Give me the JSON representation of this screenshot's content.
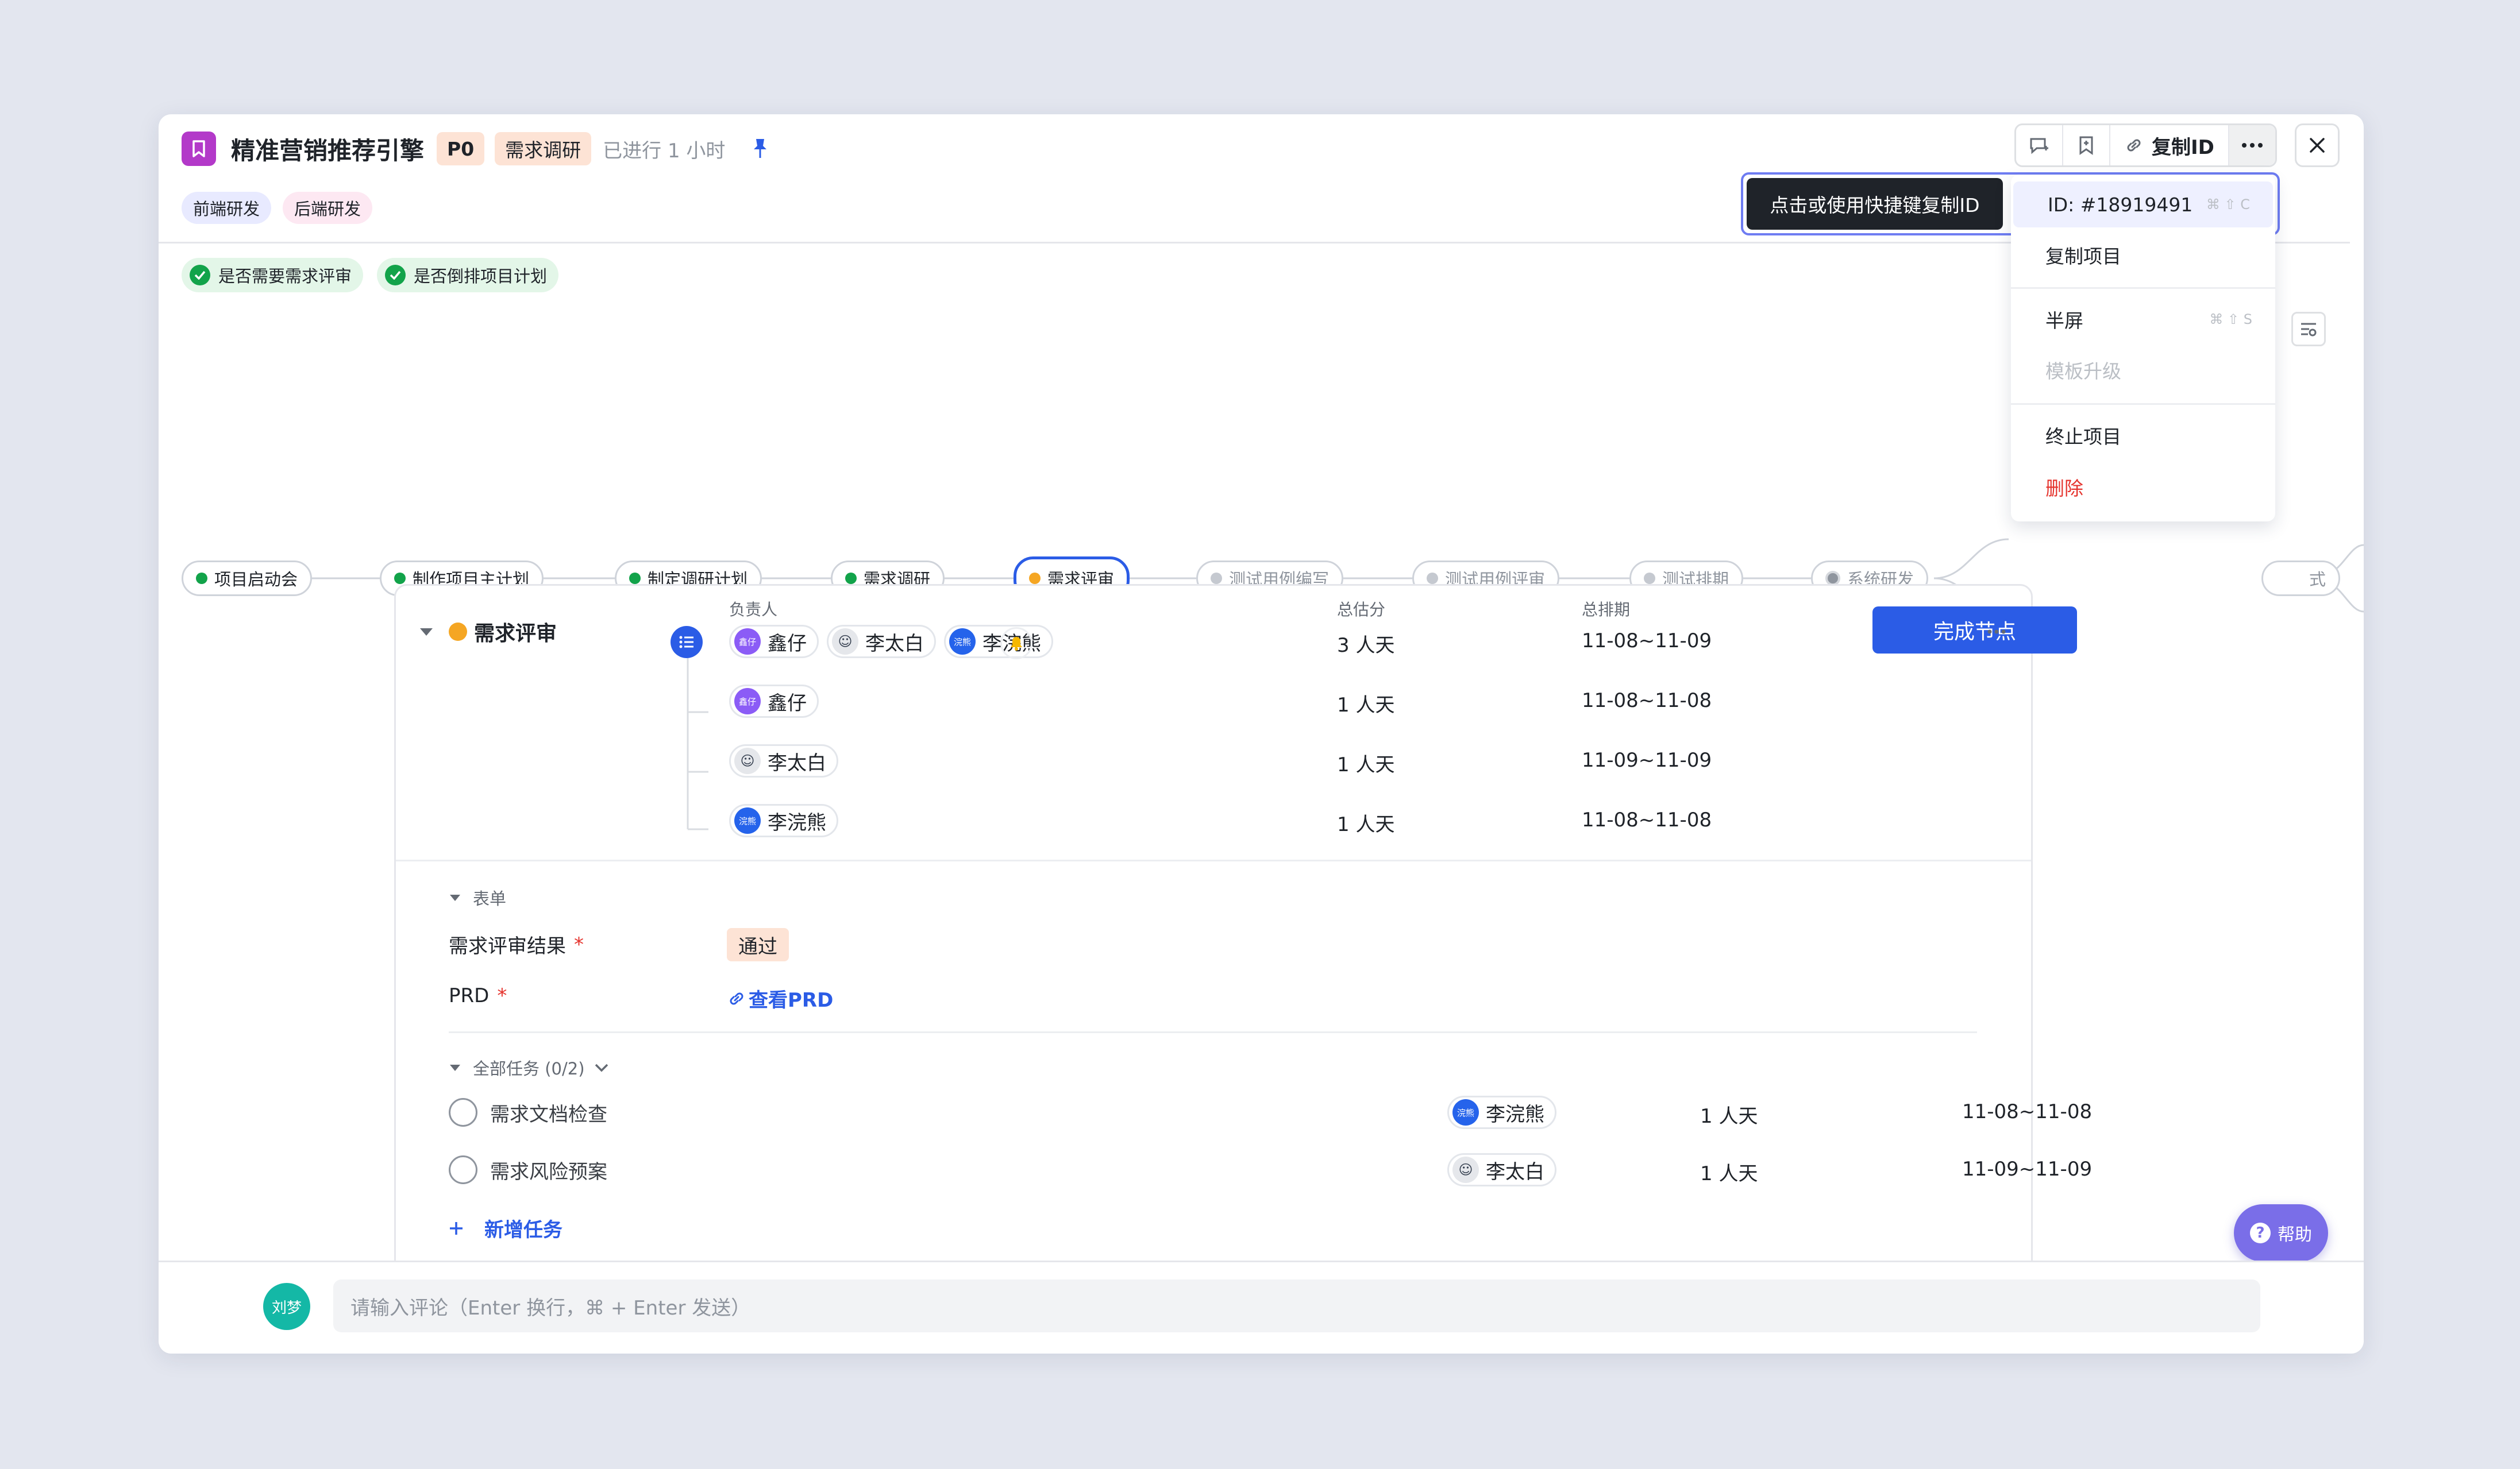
{
  "header": {
    "title": "精准营销推荐引擎",
    "priority": "P0",
    "stage": "需求调研",
    "elapsed": "已进行 1 小时",
    "copy_id_label": "复制ID"
  },
  "tags": [
    "前端研发",
    "后端研发"
  ],
  "checks": [
    "是否需要需求评审",
    "是否倒排项目计划"
  ],
  "tooltip": "点击或使用快捷键复制ID",
  "menu": {
    "id_label": "ID: #18919491",
    "id_shortcut": "⌘ ⇧ C",
    "copy_project": "复制项目",
    "half_screen": "半屏",
    "half_shortcut": "⌘ ⇧ S",
    "template_upgrade": "模板升级",
    "terminate": "终止项目",
    "delete": "删除"
  },
  "flow": {
    "nodes": [
      {
        "label": "项目启动会",
        "status": "done"
      },
      {
        "label": "制作项目主计划",
        "status": "done"
      },
      {
        "label": "制定调研计划",
        "status": "done"
      },
      {
        "label": "需求调研",
        "status": "done"
      },
      {
        "label": "需求评审",
        "status": "current"
      },
      {
        "label": "测试用例编写",
        "status": "todo"
      },
      {
        "label": "测试用例评审",
        "status": "todo"
      },
      {
        "label": "测试排期",
        "status": "todo"
      },
      {
        "label": "系统研发",
        "status": "todo"
      }
    ],
    "partial_label": "式"
  },
  "node_card": {
    "title": "需求评审",
    "headers": {
      "owner": "负责人",
      "estimate": "总估分",
      "schedule": "总排期"
    },
    "complete_button": "完成节点",
    "rows": [
      {
        "users": [
          {
            "name": "鑫仔",
            "avatar": "鑫仔"
          },
          {
            "name": "李太白",
            "avatar": "☺"
          },
          {
            "name": "李浣熊",
            "avatar": "浣熊"
          }
        ],
        "estimate": "3 人天",
        "schedule": "11-08~11-09"
      },
      {
        "users": [
          {
            "name": "鑫仔",
            "avatar": "鑫仔"
          }
        ],
        "estimate": "1 人天",
        "schedule": "11-08~11-08"
      },
      {
        "users": [
          {
            "name": "李太白",
            "avatar": "☺"
          }
        ],
        "estimate": "1 人天",
        "schedule": "11-09~11-09"
      },
      {
        "users": [
          {
            "name": "李浣熊",
            "avatar": "浣熊"
          }
        ],
        "estimate": "1 人天",
        "schedule": "11-08~11-08"
      }
    ]
  },
  "form": {
    "section_title": "表单",
    "review_result_label": "需求评审结果",
    "review_result_value": "通过",
    "prd_label": "PRD",
    "prd_link": "查看PRD",
    "required_mark": "*"
  },
  "tasks": {
    "section_title": "全部任务 (0/2)",
    "items": [
      {
        "name": "需求文档检查",
        "owner": "李浣熊",
        "avatar": "浣熊",
        "estimate": "1 人天",
        "schedule": "11-08~11-08"
      },
      {
        "name": "需求风险预案",
        "owner": "李太白",
        "avatar": "☺",
        "estimate": "1 人天",
        "schedule": "11-09~11-09"
      }
    ],
    "add_task": "新增任务"
  },
  "help_label": "帮助",
  "comment": {
    "avatar": "刘梦",
    "placeholder": "请输入评论（Enter 换行，⌘ + Enter 发送）"
  },
  "colors": {
    "accent": "#2b5ce6",
    "done": "#12a34a",
    "current": "#f5a623",
    "danger": "#e5342e",
    "help": "#7a6ee8"
  }
}
